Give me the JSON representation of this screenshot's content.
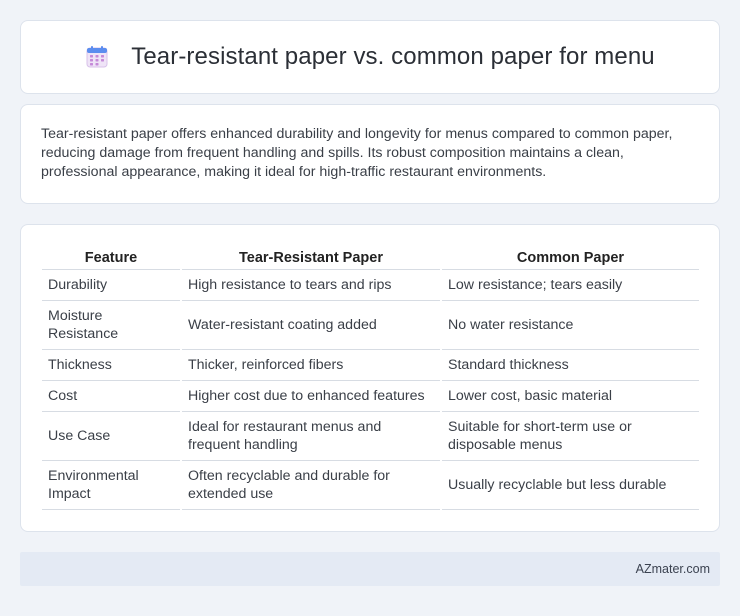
{
  "header": {
    "title": "Tear-resistant paper vs. common paper for menu",
    "icon": "calendar-icon",
    "icon_colors": {
      "top": "#5b8def",
      "grid": "#c58ad8"
    }
  },
  "summary": {
    "text": "Tear-resistant paper offers enhanced durability and longevity for menus compared to common paper, reducing damage from frequent handling and spills. Its robust composition maintains a clean, professional appearance, making it ideal for high-traffic restaurant environments."
  },
  "table": {
    "headers": [
      "Feature",
      "Tear-Resistant Paper",
      "Common Paper"
    ],
    "rows": [
      [
        "Durability",
        "High resistance to tears and rips",
        "Low resistance; tears easily"
      ],
      [
        "Moisture Resistance",
        "Water-resistant coating added",
        "No water resistance"
      ],
      [
        "Thickness",
        "Thicker, reinforced fibers",
        "Standard thickness"
      ],
      [
        "Cost",
        "Higher cost due to enhanced features",
        "Lower cost, basic material"
      ],
      [
        "Use Case",
        "Ideal for restaurant menus and frequent handling",
        "Suitable for short-term use or disposable menus"
      ],
      [
        "Environmental Impact",
        "Often recyclable and durable for extended use",
        "Usually recyclable but less durable"
      ]
    ]
  },
  "footer": {
    "brand": "AZmater.com"
  }
}
